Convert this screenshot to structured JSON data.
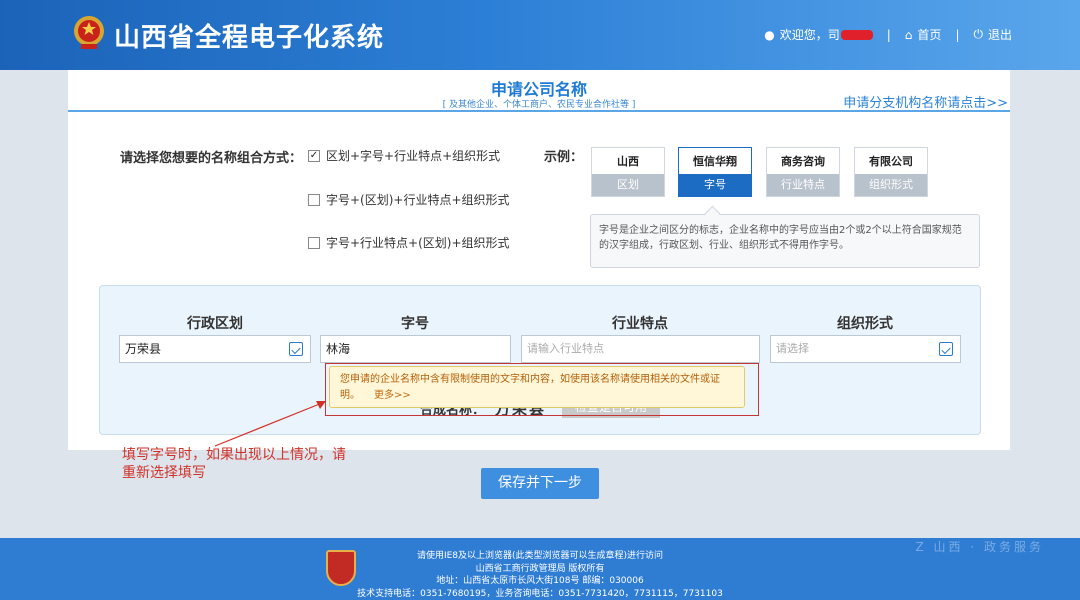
{
  "header": {
    "title": "山西省全程电子化系统",
    "welcome": "欢迎您，司",
    "home": "首页",
    "logout": "退出"
  },
  "panel": {
    "title": "申请公司名称",
    "subtitle": "[ 及其他企业、个体工商户、农民专业合作社等 ]",
    "branch_link": "申请分支机构名称请点击>>"
  },
  "combo": {
    "label": "请选择您想要的名称组合方式：",
    "options": [
      {
        "label": "区划+字号+行业特点+组织形式",
        "checked": true
      },
      {
        "label": "字号+(区划)+行业特点+组织形式",
        "checked": false
      },
      {
        "label": "字号+行业特点+(区划)+组织形式",
        "checked": false
      }
    ]
  },
  "example": {
    "label": "示例：",
    "cards": [
      {
        "top": "山西",
        "bottom": "区划"
      },
      {
        "top": "恒信华翔",
        "bottom": "字号"
      },
      {
        "top": "商务咨询",
        "bottom": "行业特点"
      },
      {
        "top": "有限公司",
        "bottom": "组织形式"
      }
    ],
    "description": "字号是企业之间区分的标志，企业名称中的字号应当由2个或2个以上符合国家规范的汉字组成，行政区划、行业、组织形式不得用作字号。"
  },
  "form": {
    "headers": [
      "行政区划",
      "字号",
      "行业特点",
      "组织形式"
    ],
    "region_value": "万荣县",
    "tradename_value": "林海",
    "industry_placeholder": "请输入行业特点",
    "orgform_placeholder": "请选择",
    "result_label": "合成名称：",
    "result_value": "万荣县",
    "check_button": "检查是否可用"
  },
  "warning": {
    "text": "您申请的企业名称中含有限制使用的文字和内容，如使用该名称请使用相关的文件或证明。",
    "more": "更多>>"
  },
  "annotation": {
    "line1": "填写字号时，如果出现以上情况，请",
    "line2": "重新选择填写"
  },
  "save_button": "保存并下一步",
  "footer": {
    "line1": "请使用IE8及以上浏览器(此类型浏览器可以生成章程)进行访问",
    "line2": "山西省工商行政管理局 版权所有",
    "line3": "地址：山西省太原市长风大街108号 邮编：030006",
    "line4": "技术支持电话：0351-7680195，业务咨询电话：0351-7731420，7731115，7731103",
    "watermark": "Z 山西 · 政务服务"
  }
}
